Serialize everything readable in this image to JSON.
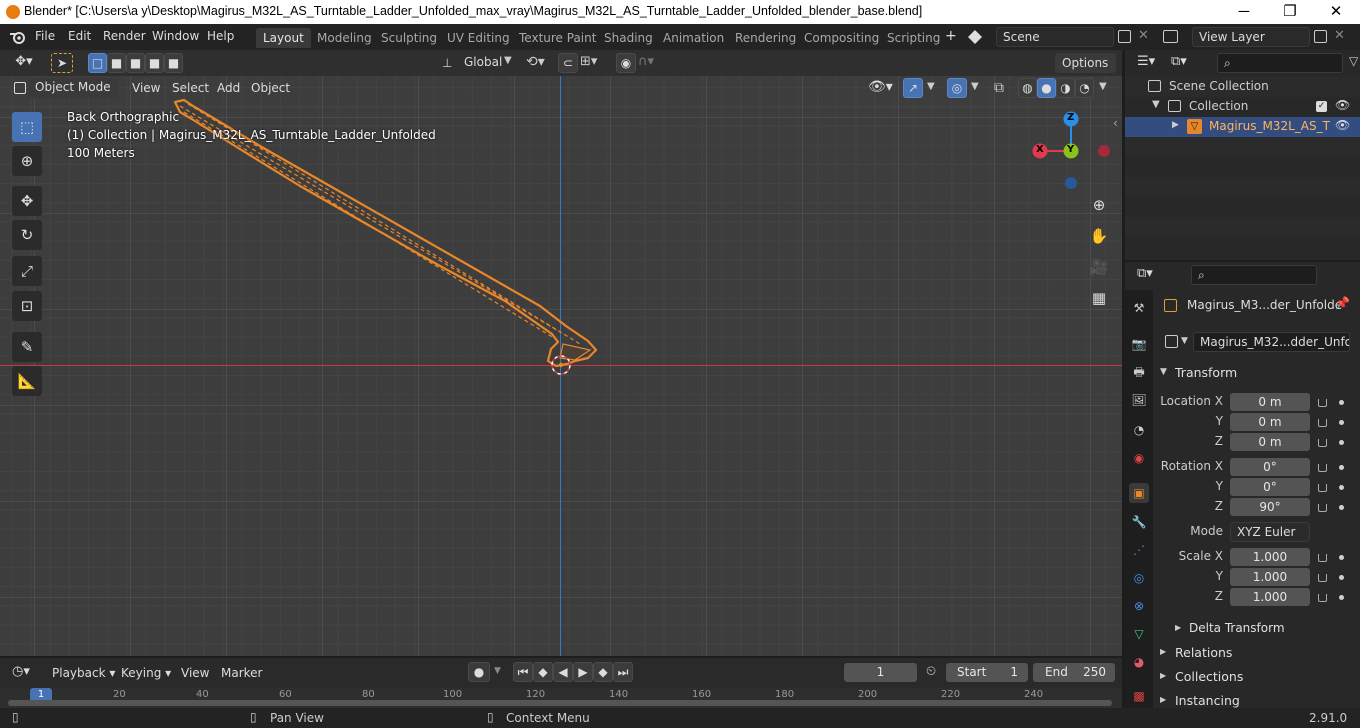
{
  "window": {
    "title": "Blender* [C:\\Users\\a y\\Desktop\\Magirus_M32L_AS_Turntable_Ladder_Unfolded_max_vray\\Magirus_M32L_AS_Turntable_Ladder_Unfolded_blender_base.blend]",
    "minimize": "─",
    "maximize": "❐",
    "close": "✕"
  },
  "menu": {
    "file": "File",
    "edit": "Edit",
    "render": "Render",
    "window": "Window",
    "help": "Help"
  },
  "workspaces": [
    "Layout",
    "Modeling",
    "Sculpting",
    "UV Editing",
    "Texture Paint",
    "Shading",
    "Animation",
    "Rendering",
    "Compositing",
    "Scripting"
  ],
  "scene": {
    "name": "Scene",
    "view_layer": "View Layer"
  },
  "toolheader": {
    "orientation": "Global",
    "options": "Options"
  },
  "viewport": {
    "mode": "Object Mode",
    "menu_view": "View",
    "menu_select": "Select",
    "menu_add": "Add",
    "menu_object": "Object",
    "view_name": "Back Orthographic",
    "collection_info": "(1) Collection | Magirus_M32L_AS_Turntable_Ladder_Unfolded",
    "scale_info": "100 Meters",
    "gizmo": {
      "z": "Z",
      "y": "Y",
      "x": "X"
    },
    "colors": {
      "x_axis": "#e03a4e",
      "y_axis": "#8ac31a",
      "z_axis": "#2a8fe8",
      "selection": "#e8862a"
    }
  },
  "outliner": {
    "scene_collection": "Scene Collection",
    "collection": "Collection",
    "object": "Magirus_M32L_AS_T"
  },
  "properties": {
    "object_name": "Magirus_M3...der_Unfolde",
    "data_name": "Magirus_M32...dder_Unfolded",
    "transform_header": "Transform",
    "location_label": "Location X",
    "y_label": "Y",
    "z_label": "Z",
    "location": [
      "0 m",
      "0 m",
      "0 m"
    ],
    "rotation_label": "Rotation X",
    "rotation": [
      "0°",
      "0°",
      "90°"
    ],
    "mode_label": "Mode",
    "mode_value": "XYZ Euler",
    "scale_label": "Scale X",
    "scale": [
      "1.000",
      "1.000",
      "1.000"
    ],
    "delta_transform": "Delta Transform",
    "relations": "Relations",
    "collections": "Collections",
    "instancing": "Instancing"
  },
  "timeline": {
    "playback": "Playback",
    "keying": "Keying",
    "view": "View",
    "marker": "Marker",
    "current_frame": "1",
    "start_label": "Start",
    "start": "1",
    "end_label": "End",
    "end": "250",
    "ruler": [
      "1",
      "20",
      "40",
      "60",
      "80",
      "100",
      "120",
      "140",
      "160",
      "180",
      "200",
      "220",
      "240"
    ]
  },
  "status": {
    "pan_view": "Pan View",
    "context_menu": "Context Menu",
    "version": "2.91.0"
  }
}
